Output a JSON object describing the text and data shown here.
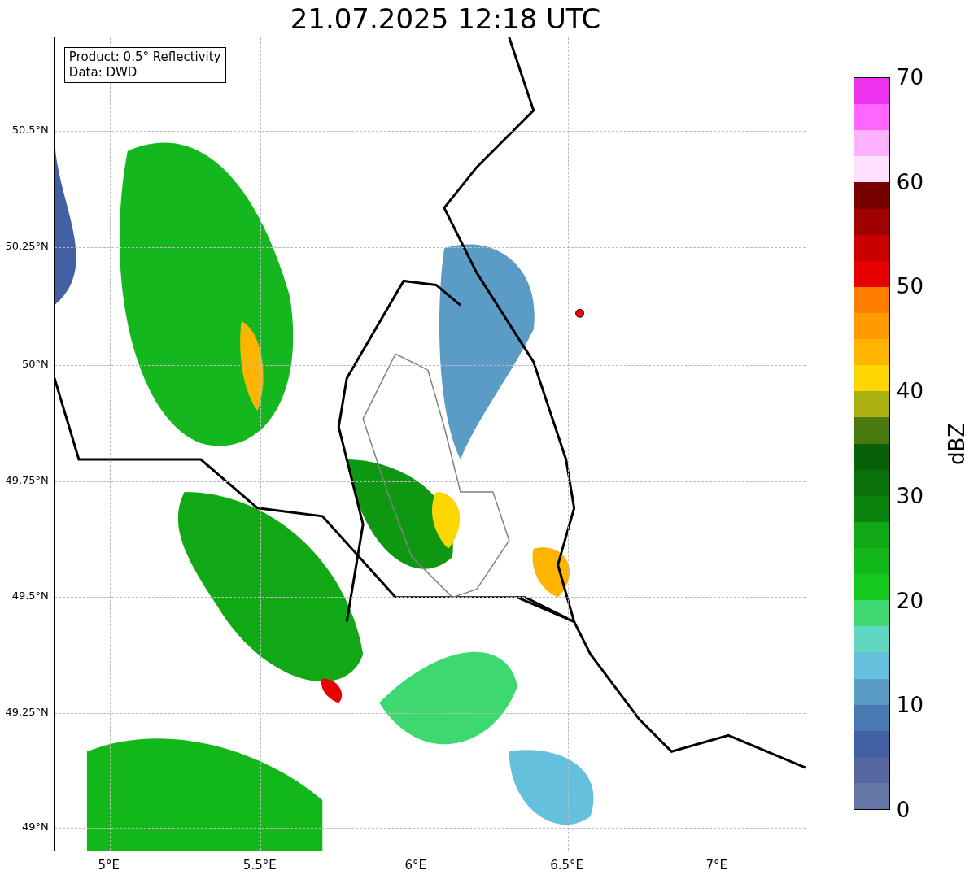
{
  "title": "21.07.2025 12:18 UTC",
  "legend": {
    "lines": [
      "Product: 0.5° Reflectivity",
      "Data: DWD"
    ]
  },
  "y_ticks": [
    "50.5°N",
    "50.25°N",
    "50°N",
    "49.75°N",
    "49.5°N",
    "49.25°N",
    "49°N"
  ],
  "x_ticks": [
    "5°E",
    "5.5°E",
    "6°E",
    "6.5°E",
    "7°E"
  ],
  "colorbar": {
    "label": "dBZ",
    "ticks": [
      "70",
      "60",
      "50",
      "40",
      "30",
      "20",
      "10",
      "0"
    ],
    "bins": [
      {
        "color": "#ee33ee"
      },
      {
        "color": "#ff66ff"
      },
      {
        "color": "#ffb0ff"
      },
      {
        "color": "#ffe0ff"
      },
      {
        "color": "#780000"
      },
      {
        "color": "#a00000"
      },
      {
        "color": "#c80000"
      },
      {
        "color": "#e60000"
      },
      {
        "color": "#ff7e00"
      },
      {
        "color": "#ff9a00"
      },
      {
        "color": "#ffb400"
      },
      {
        "color": "#ffd700"
      },
      {
        "color": "#aab010"
      },
      {
        "color": "#487a10"
      },
      {
        "color": "#086008"
      },
      {
        "color": "#0a700a"
      },
      {
        "color": "#0c820e"
      },
      {
        "color": "#10a814"
      },
      {
        "color": "#12b81a"
      },
      {
        "color": "#14c81e"
      },
      {
        "color": "#3ed870"
      },
      {
        "color": "#5ed6c0"
      },
      {
        "color": "#64c0dc"
      },
      {
        "color": "#5a9cc6"
      },
      {
        "color": "#4a78b0"
      },
      {
        "color": "#4460a4"
      },
      {
        "color": "#5566a0"
      },
      {
        "color": "#6475a6"
      }
    ]
  }
}
